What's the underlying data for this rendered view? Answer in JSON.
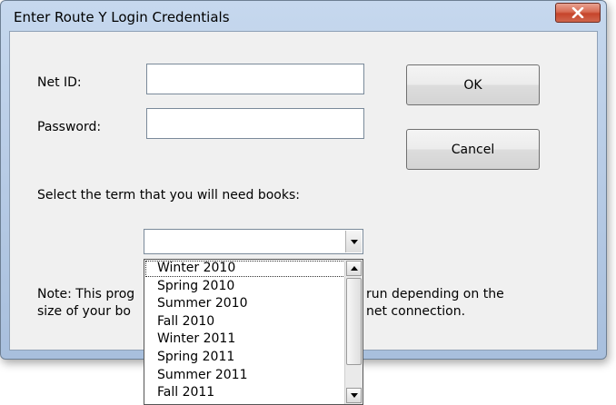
{
  "window": {
    "title": "Enter Route Y Login Credentials",
    "close_icon": "close-icon"
  },
  "form": {
    "netid_label": "Net ID:",
    "netid_value": "",
    "password_label": "Password:",
    "password_value": "",
    "term_prompt": "Select the term that you will need books:",
    "term_selected": ""
  },
  "buttons": {
    "ok_label": "OK",
    "cancel_label": "Cancel"
  },
  "note": {
    "line1_left": "Note: This prog",
    "line1_right": "run depending on the",
    "line2_left": "size of your bo",
    "line2_right": "net connection."
  },
  "term_options": [
    "Winter 2010",
    "Spring 2010",
    "Summer 2010",
    "Fall 2010",
    "Winter 2011",
    "Spring 2011",
    "Summer 2011",
    "Fall 2011"
  ],
  "highlighted_option_index": 0
}
